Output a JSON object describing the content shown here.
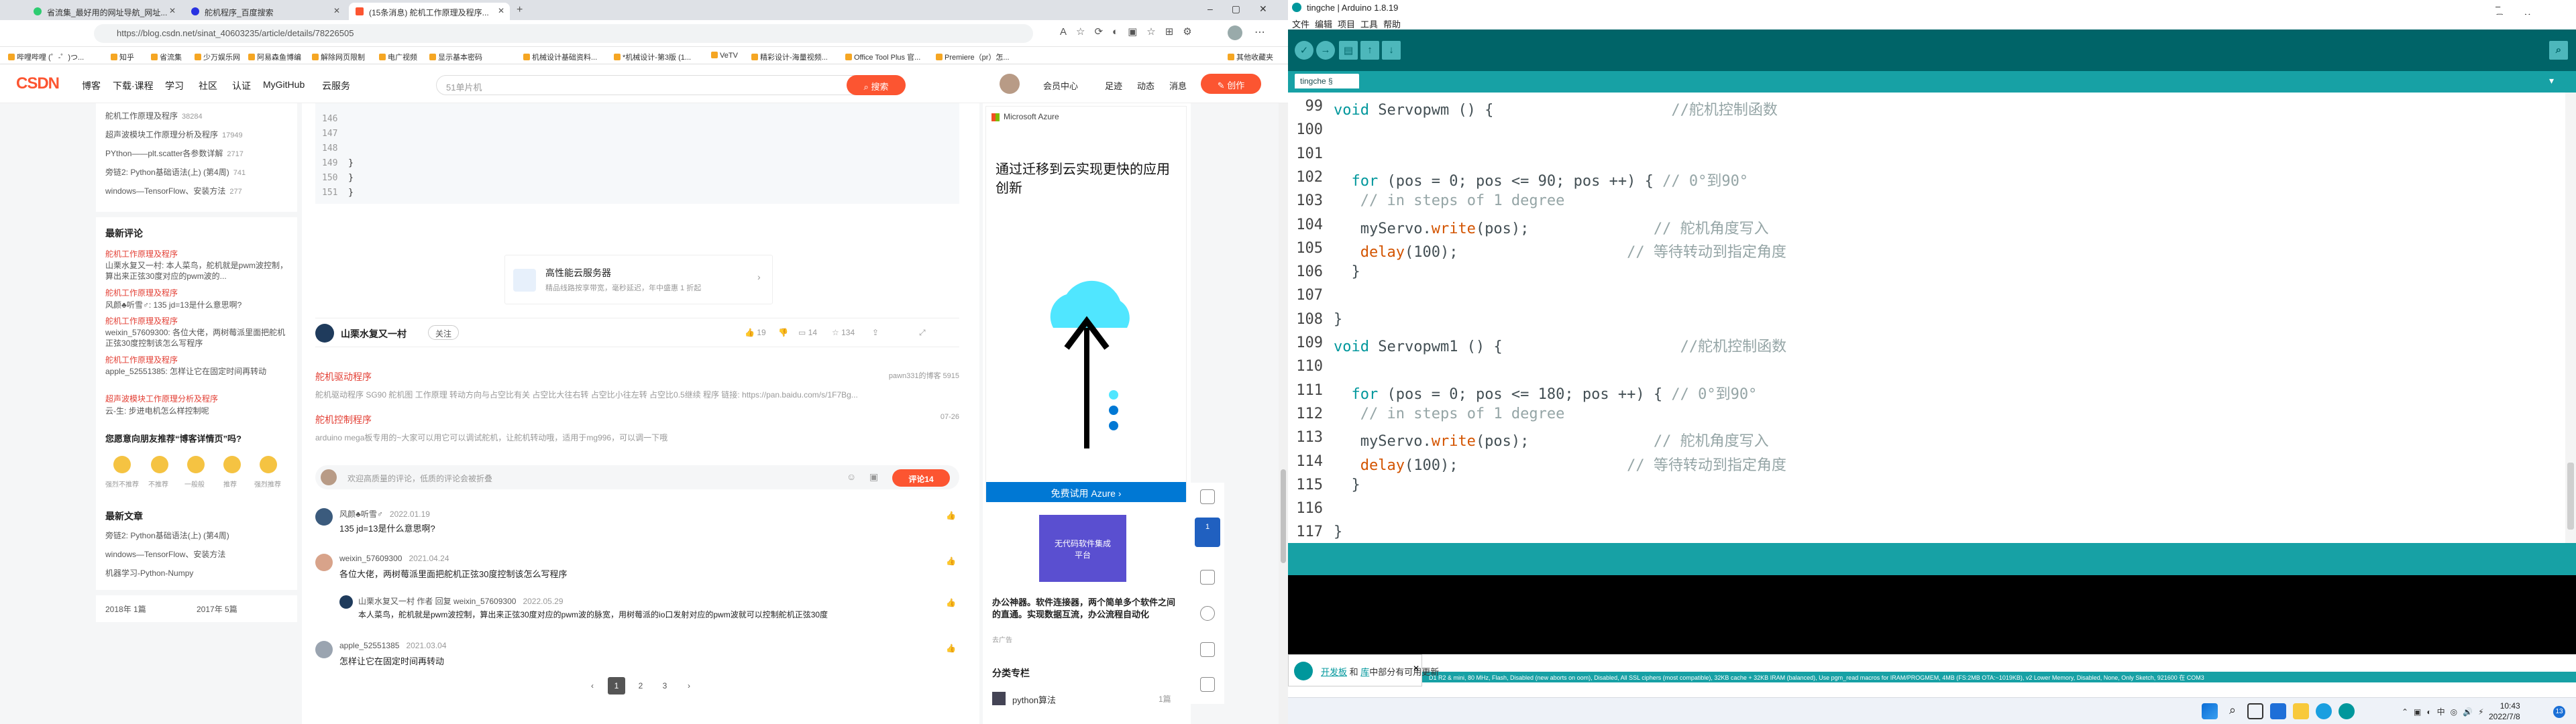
{
  "browser": {
    "tabs": [
      {
        "label": "省流集_最好用的网址导航_网址..."
      },
      {
        "label": "舵机程序_百度搜索"
      },
      {
        "label": "(15条消息) 舵机工作原理及程序..."
      }
    ],
    "url": "https://blog.csdn.net/sinat_40603235/article/details/78226505",
    "bookmarks": [
      "哔哩哔哩 (゜-゜)つ...",
      "知乎",
      "省流集",
      "少万娱乐网",
      "阿易森鱼博编",
      "解除网页限制",
      "电广视频",
      "显示基本密码",
      "机械设计基础资料...",
      "*机械设计-第3版 (1...",
      "VeTV",
      "精彩设计-海量视频...",
      "Office Tool Plus 官...",
      "Premiere（pr）怎...",
      "其他收藏夹"
    ]
  },
  "csdn": {
    "logo": "CSDN",
    "nav": [
      "博客",
      "下载·课程",
      "学习",
      "社区",
      "认证",
      "MyGitHub",
      "云服务"
    ],
    "search_placeholder": "51单片机",
    "search_button": "搜索",
    "user_links": [
      "会员中心",
      "足迹",
      "动态",
      "消息"
    ],
    "create_button": "创作"
  },
  "left": {
    "hot_items": [
      {
        "title": "舵机工作原理及程序",
        "count": "38284"
      },
      {
        "title": "超声波模块工作原理分析及程序",
        "count": "17949"
      },
      {
        "title": "PYthon——plt.scatter各参数详解",
        "count": "2717"
      },
      {
        "title": "旁链2: Python基础语法(上) (第4周)",
        "count": "741"
      },
      {
        "title": "windows—TensorFlow、安装方法",
        "count": "277"
      }
    ],
    "recent_comments_title": "最新评论",
    "recent_comments": [
      {
        "article": "舵机工作原理及程序",
        "text": "山栗水复又一村: 本人菜鸟，舵机就是pwm波控制，算出来正弦30度对应的pwm波的..."
      },
      {
        "article": "舵机工作原理及程序",
        "text": "风颜♣听雪♂: 135 jd=13是什么意思啊?"
      },
      {
        "article": "舵机工作原理及程序",
        "text": "weixin_57609300: 各位大佬，两树莓派里面把舵机正弦30度控制该怎么写程序"
      },
      {
        "article": "舵机工作原理及程序",
        "text": "apple_52551385: 怎样让它在固定时间再转动"
      },
      {
        "article": "超声波模块工作原理分析及程序",
        "text": "云-生: 步进电机怎么样控制呢"
      }
    ],
    "feedback_title": "您愿意向朋友推荐“博客详情页”吗?",
    "feedback_options": [
      "强烈不推荐",
      "不推荐",
      "一般般",
      "推荐",
      "强烈推荐"
    ],
    "latest_title": "最新文章",
    "latest": [
      "旁链2: Python基础语法(上) (第4周)",
      "windows—TensorFlow、安装方法",
      "机器学习-Python-Numpy"
    ],
    "archive": [
      {
        "year": "2018年",
        "count": "1篇"
      },
      {
        "year": "2017年",
        "count": "5篇"
      }
    ]
  },
  "main": {
    "code_lines": [
      {
        "n": "146",
        "t": ""
      },
      {
        "n": "147",
        "t": ""
      },
      {
        "n": "148",
        "t": ""
      },
      {
        "n": "149",
        "t": "}"
      },
      {
        "n": "150",
        "t": "}"
      },
      {
        "n": "151",
        "t": "}"
      }
    ],
    "sponsor_title": "高性能云服务器",
    "sponsor_desc": "精品线路按享带宽，毫秒延迟，年中盛惠 1 折起",
    "author": "山栗水复又一村",
    "follow": "关注",
    "likes": "19",
    "comments": "14",
    "favorites": "134",
    "related": [
      {
        "title": "舵机驱动程序",
        "meta": "pawn331的博客  5915",
        "desc": "舵机驱动程序 SG90 舵机图 工作原理 转动方向与占空比有关 占空比大往右转 占空比小往左转 占空比0.5继续 程序 链接: https://pan.baidu.com/s/1F7Bg..."
      },
      {
        "title": "舵机控制程序",
        "meta": "07-26",
        "desc": "arduino mega板专用的~大家可以用它可以调试舵机，让舵机转动哦，适用于mg996，可以调一下哦"
      }
    ],
    "comment_placeholder": "欢迎高质量的评论，低质的评论会被折叠",
    "comment_submit": "评论14",
    "comments_list": [
      {
        "user": "风颜♣听雪♂",
        "date": "2022.01.19",
        "text": "135 jd=13是什么意思啊?"
      },
      {
        "user": "weixin_57609300",
        "date": "2021.04.24",
        "text": "各位大佬，两树莓派里面把舵机正弦30度控制该怎么写程序"
      },
      {
        "user": "山栗水复又一村 作者  回复 weixin_57609300",
        "date": "2022.05.29",
        "text": "本人菜鸟，舵机就是pwm波控制，算出来正弦30度对应的pwm波的脉宽，用树莓派的io口发射对应的pwm波就可以控制舵机正弦30度"
      },
      {
        "user": "apple_52551385",
        "date": "2021.03.04",
        "text": "怎样让它在固定时间再转动"
      }
    ],
    "pages": [
      "1",
      "2",
      "3"
    ]
  },
  "ad": {
    "brand": "Microsoft Azure",
    "headline": "通过迁移到云实现更快的应用创新",
    "cta": "免费试用 Azure",
    "promo_title": "无代码软件集成平台",
    "promo_sub": "办公神器。软件连接器，两个简单多个软件之间的直通。实现数据互流，办公流程自动化",
    "promo_tag": "去广告",
    "column_title": "分类专栏",
    "column_item": "python算法",
    "column_count": "1篇"
  },
  "arduino": {
    "title": "tingche | Arduino 1.8.19",
    "menus": [
      "文件",
      "编辑",
      "项目",
      "工具",
      "帮助"
    ],
    "tab": "tingche §",
    "code": [
      {
        "n": "99",
        "t": [
          [
            "ty",
            "void "
          ],
          [
            "",
            "Servopwm () {                    "
          ],
          [
            "cm",
            "//舵机控制函数"
          ]
        ]
      },
      {
        "n": "100",
        "t": [
          [
            "",
            ""
          ]
        ]
      },
      {
        "n": "101",
        "t": [
          [
            "",
            ""
          ]
        ]
      },
      {
        "n": "102",
        "t": [
          [
            "",
            "  "
          ],
          [
            "kw",
            "for"
          ],
          [
            "",
            " (pos = 0; pos <= 90; pos ++) { "
          ],
          [
            "cm",
            "// 0°到90°"
          ]
        ]
      },
      {
        "n": "103",
        "t": [
          [
            "",
            "   "
          ],
          [
            "cm",
            "// in steps of 1 degree"
          ]
        ]
      },
      {
        "n": "104",
        "t": [
          [
            "",
            "   myServo."
          ],
          [
            "fn",
            "write"
          ],
          [
            "",
            "(pos);              "
          ],
          [
            "cm",
            "// 舵机角度写入"
          ]
        ]
      },
      {
        "n": "105",
        "t": [
          [
            "",
            "   "
          ],
          [
            "fn",
            "delay"
          ],
          [
            "",
            "(100);                   "
          ],
          [
            "cm",
            "// 等待转动到指定角度"
          ]
        ]
      },
      {
        "n": "106",
        "t": [
          [
            "",
            "  }"
          ]
        ]
      },
      {
        "n": "107",
        "t": [
          [
            "",
            ""
          ]
        ]
      },
      {
        "n": "108",
        "t": [
          [
            "",
            "}"
          ]
        ]
      },
      {
        "n": "109",
        "t": [
          [
            "ty",
            "void "
          ],
          [
            "",
            "Servopwm1 () {                    "
          ],
          [
            "cm",
            "//舵机控制函数"
          ]
        ]
      },
      {
        "n": "110",
        "t": [
          [
            "",
            ""
          ]
        ]
      },
      {
        "n": "111",
        "t": [
          [
            "",
            "  "
          ],
          [
            "kw",
            "for"
          ],
          [
            "",
            " (pos = 0; pos <= 180; pos ++) { "
          ],
          [
            "cm",
            "// 0°到90°"
          ]
        ]
      },
      {
        "n": "112",
        "t": [
          [
            "",
            "   "
          ],
          [
            "cm",
            "// in steps of 1 degree"
          ]
        ]
      },
      {
        "n": "113",
        "t": [
          [
            "",
            "   myServo."
          ],
          [
            "fn",
            "write"
          ],
          [
            "",
            "(pos);              "
          ],
          [
            "cm",
            "// 舵机角度写入"
          ]
        ]
      },
      {
        "n": "114",
        "t": [
          [
            "",
            "   "
          ],
          [
            "fn",
            "delay"
          ],
          [
            "",
            "(100);                   "
          ],
          [
            "cm",
            "// 等待转动到指定角度"
          ]
        ]
      },
      {
        "n": "115",
        "t": [
          [
            "",
            "  }"
          ]
        ]
      },
      {
        "n": "116",
        "t": [
          [
            "",
            ""
          ]
        ]
      },
      {
        "n": "117",
        "t": [
          [
            "",
            "}"
          ]
        ]
      }
    ],
    "status": "D1 R2 & mini, 80 MHz, Flash, Disabled (new aborts on oom), Disabled, All SSL ciphers (most compatible), 32KB cache + 32KB IRAM (balanced), Use pgm_read macros for IRAM/PROGMEM, 4MB (FS:2MB OTA:~1019KB), v2 Lower Memory, Disabled, None, Only Sketch, 921600 在 COM3",
    "notification": {
      "link1": "开发板",
      "mid": " 和 ",
      "link2": "库",
      "rest": "中部分有可用更新"
    }
  },
  "taskbar": {
    "time": "10:43",
    "date": "2022/7/8",
    "ime": "中",
    "badge": "13"
  }
}
